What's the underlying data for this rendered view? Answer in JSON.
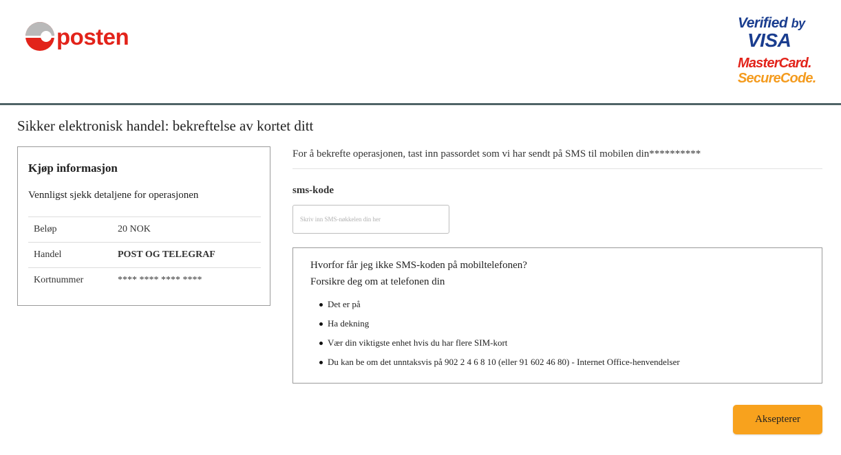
{
  "header": {
    "logo_text": "posten",
    "verified_by_visa_line1": "Verified",
    "verified_by_visa_by": "by",
    "verified_by_visa_line2": "VISA",
    "mastercard_line1": "MasterCard.",
    "mastercard_line2": "SecureCode."
  },
  "page_title": "Sikker elektronisk handel: bekreftelse av kortet ditt",
  "purchase_info": {
    "title": "Kjøp informasjon",
    "subtitle": "Vennligst sjekk detaljene for operasjonen",
    "rows": [
      {
        "label": "Beløp",
        "value": "20 NOK"
      },
      {
        "label": "Handel",
        "value": "POST OG TELEGRAF"
      },
      {
        "label": "Kortnummer",
        "value": "**** **** **** ****"
      }
    ]
  },
  "instruction": "For å bekrefte operasjonen, tast inn passordet som vi har sendt på SMS til mobilen din**********",
  "sms": {
    "label": "sms-kode",
    "value": "",
    "placeholder": "Skriv inn SMS-nøkkelen din her"
  },
  "help": {
    "title": "Hvorfor får jeg ikke SMS-koden på mobiltelefonen?",
    "subtitle": "Forsikre deg om at telefonen din",
    "items": [
      "Det er på",
      "Ha dekning",
      "Vær din viktigste enhet hvis du har flere SIM-kort",
      "Du kan be om det unntaksvis på 902 2 4 6 8 10 (eller 91 602 46 80) - Internet Office-henvendelser"
    ]
  },
  "accept_button_label": "Aksepterer",
  "colors": {
    "brand_red": "#e2231a",
    "header_rule": "#4f6366",
    "accept_orange": "#f8a21d",
    "visa_blue": "#1a3d8f",
    "mastercard_orange": "#f49b1e"
  }
}
